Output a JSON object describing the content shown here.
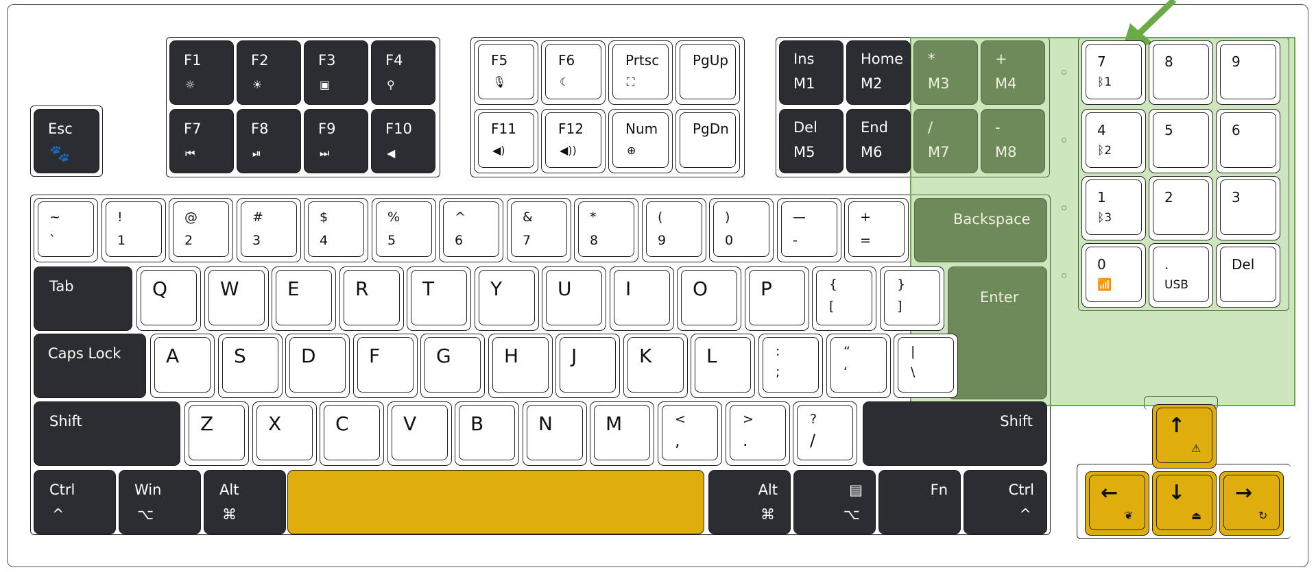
{
  "colors": {
    "dark_key": "#2b2d33",
    "light_key": "#ffffff",
    "accent_yellow": "#dfae0c",
    "highlight_green": "#8ac362",
    "arrow_green": "#6aab48"
  },
  "esc": {
    "label": "Esc",
    "icon": "bear-icon"
  },
  "fn_row": [
    {
      "label": "F1",
      "icon": "☼"
    },
    {
      "label": "F2",
      "icon": "☀"
    },
    {
      "label": "F3",
      "icon": "▣"
    },
    {
      "label": "F4",
      "icon": "⚲"
    },
    {
      "label": "F7",
      "icon": "⏮"
    },
    {
      "label": "F8",
      "icon": "⏯"
    },
    {
      "label": "F9",
      "icon": "⏭"
    },
    {
      "label": "F10",
      "icon": "◀"
    },
    {
      "label": "F5",
      "icon": "🎙"
    },
    {
      "label": "F6",
      "icon": "☾"
    },
    {
      "label": "Prtsc",
      "icon": "⛶"
    },
    {
      "label": "PgUp",
      "icon": ""
    },
    {
      "label": "F11",
      "icon": "◀)"
    },
    {
      "label": "F12",
      "icon": "◀))"
    },
    {
      "label": "Num",
      "icon": "⊕"
    },
    {
      "label": "PgDn",
      "icon": ""
    }
  ],
  "nav": [
    {
      "top": "Ins",
      "bottom": "M1"
    },
    {
      "top": "Home",
      "bottom": "M2"
    },
    {
      "top": "*",
      "bottom": "M3"
    },
    {
      "top": "+",
      "bottom": "M4"
    },
    {
      "top": "Del",
      "bottom": "M5"
    },
    {
      "top": "End",
      "bottom": "M6"
    },
    {
      "top": "/",
      "bottom": "M7"
    },
    {
      "top": "-",
      "bottom": "M8"
    }
  ],
  "numpad": [
    {
      "top": "7",
      "bottom": "ᛒ1"
    },
    {
      "top": "8",
      "bottom": ""
    },
    {
      "top": "9",
      "bottom": ""
    },
    {
      "top": "4",
      "bottom": "ᛒ2"
    },
    {
      "top": "5",
      "bottom": ""
    },
    {
      "top": "6",
      "bottom": ""
    },
    {
      "top": "1",
      "bottom": "ᛒ3"
    },
    {
      "top": "2",
      "bottom": ""
    },
    {
      "top": "3",
      "bottom": ""
    },
    {
      "top": "0",
      "bottom": "📶"
    },
    {
      "top": ".",
      "bottom": "USB"
    },
    {
      "top": "Del",
      "bottom": ""
    }
  ],
  "number_row": [
    {
      "top": "~",
      "bottom": "`"
    },
    {
      "top": "!",
      "bottom": "1"
    },
    {
      "top": "@",
      "bottom": "2"
    },
    {
      "top": "#",
      "bottom": "3"
    },
    {
      "top": "$",
      "bottom": "4"
    },
    {
      "top": "%",
      "bottom": "5"
    },
    {
      "top": "^",
      "bottom": "6"
    },
    {
      "top": "&",
      "bottom": "7"
    },
    {
      "top": "*",
      "bottom": "8"
    },
    {
      "top": "(",
      "bottom": "9"
    },
    {
      "top": ")",
      "bottom": "0"
    },
    {
      "top": "—",
      "bottom": "-"
    },
    {
      "top": "+",
      "bottom": "="
    }
  ],
  "backspace": "Backspace",
  "tab": "Tab",
  "qwerty": [
    "Q",
    "W",
    "E",
    "R",
    "T",
    "Y",
    "U",
    "I",
    "O",
    "P"
  ],
  "bracket_keys": [
    {
      "top": "{",
      "bottom": "["
    },
    {
      "top": "}",
      "bottom": "]"
    }
  ],
  "enter": "Enter",
  "caps": "Caps Lock",
  "home_row": [
    "A",
    "S",
    "D",
    "F",
    "G",
    "H",
    "J",
    "K",
    "L"
  ],
  "home_punct": [
    {
      "top": ":",
      "bottom": ";"
    },
    {
      "top": "“",
      "bottom": "‘"
    },
    {
      "top": "|",
      "bottom": "\\"
    }
  ],
  "shift_left": "Shift",
  "shift_right": "Shift",
  "bottom_letters": [
    "Z",
    "X",
    "C",
    "V",
    "B",
    "N",
    "M"
  ],
  "bottom_punct": [
    {
      "top": "<",
      "bottom": ","
    },
    {
      "top": ">",
      "bottom": "."
    },
    {
      "top": "?",
      "bottom": "/"
    }
  ],
  "mods": [
    {
      "top": "Ctrl",
      "bottom": "^"
    },
    {
      "top": "Win",
      "bottom": "⌥"
    },
    {
      "top": "Alt",
      "bottom": "⌘"
    },
    {
      "top": "Alt",
      "bottom": "⌘"
    },
    {
      "top": "▤",
      "bottom": "⌥"
    },
    {
      "top": "Fn",
      "bottom": ""
    },
    {
      "top": "Ctrl",
      "bottom": "^"
    }
  ],
  "arrows": [
    {
      "glyph": "↑",
      "icon": "⚠"
    },
    {
      "glyph": "←",
      "icon": "❦"
    },
    {
      "glyph": "↓",
      "icon": "⏏"
    },
    {
      "glyph": "→",
      "icon": "↻"
    }
  ]
}
